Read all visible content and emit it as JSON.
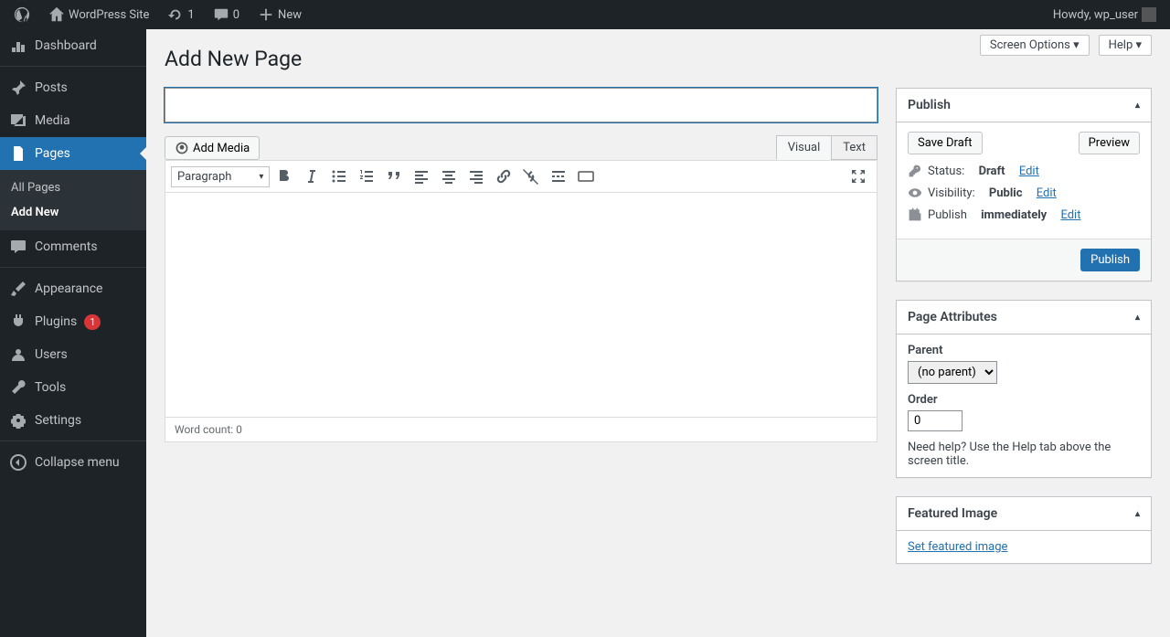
{
  "topbar": {
    "site_name": "WordPress Site",
    "updates_count": "1",
    "comments_count": "0",
    "new_label": "New",
    "greeting": "Howdy, wp_user"
  },
  "screen_options_label": "Screen Options ▾",
  "help_label": "Help ▾",
  "page_heading": "Add New Page",
  "sidebar": {
    "dashboard": "Dashboard",
    "posts": "Posts",
    "media": "Media",
    "pages": "Pages",
    "all_pages": "All Pages",
    "add_new": "Add New",
    "comments": "Comments",
    "appearance": "Appearance",
    "plugins": "Plugins",
    "plugins_badge": "1",
    "users": "Users",
    "tools": "Tools",
    "settings": "Settings",
    "collapse": "Collapse menu"
  },
  "editor": {
    "add_media": "Add Media",
    "visual_tab": "Visual",
    "text_tab": "Text",
    "format_label": "Paragraph",
    "word_count": "Word count: 0"
  },
  "publish": {
    "title": "Publish",
    "save_draft": "Save Draft",
    "preview": "Preview",
    "status_label": "Status:",
    "status_value": "Draft",
    "visibility_label": "Visibility:",
    "visibility_value": "Public",
    "publish_label": "Publish",
    "publish_value": "immediately",
    "edit": "Edit",
    "publish_button": "Publish"
  },
  "attributes": {
    "title": "Page Attributes",
    "parent_label": "Parent",
    "parent_value": "(no parent)",
    "order_label": "Order",
    "order_value": "0",
    "help_text": "Need help? Use the Help tab above the screen title."
  },
  "featured": {
    "title": "Featured Image",
    "link": "Set featured image"
  }
}
